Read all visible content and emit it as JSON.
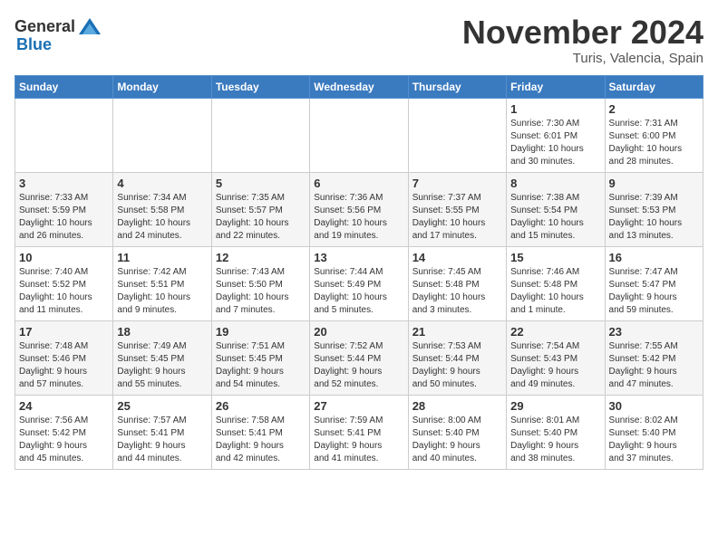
{
  "logo": {
    "general": "General",
    "blue": "Blue"
  },
  "header": {
    "month": "November 2024",
    "location": "Turis, Valencia, Spain"
  },
  "weekdays": [
    "Sunday",
    "Monday",
    "Tuesday",
    "Wednesday",
    "Thursday",
    "Friday",
    "Saturday"
  ],
  "weeks": [
    [
      {
        "day": "",
        "info": ""
      },
      {
        "day": "",
        "info": ""
      },
      {
        "day": "",
        "info": ""
      },
      {
        "day": "",
        "info": ""
      },
      {
        "day": "",
        "info": ""
      },
      {
        "day": "1",
        "info": "Sunrise: 7:30 AM\nSunset: 6:01 PM\nDaylight: 10 hours\nand 30 minutes."
      },
      {
        "day": "2",
        "info": "Sunrise: 7:31 AM\nSunset: 6:00 PM\nDaylight: 10 hours\nand 28 minutes."
      }
    ],
    [
      {
        "day": "3",
        "info": "Sunrise: 7:33 AM\nSunset: 5:59 PM\nDaylight: 10 hours\nand 26 minutes."
      },
      {
        "day": "4",
        "info": "Sunrise: 7:34 AM\nSunset: 5:58 PM\nDaylight: 10 hours\nand 24 minutes."
      },
      {
        "day": "5",
        "info": "Sunrise: 7:35 AM\nSunset: 5:57 PM\nDaylight: 10 hours\nand 22 minutes."
      },
      {
        "day": "6",
        "info": "Sunrise: 7:36 AM\nSunset: 5:56 PM\nDaylight: 10 hours\nand 19 minutes."
      },
      {
        "day": "7",
        "info": "Sunrise: 7:37 AM\nSunset: 5:55 PM\nDaylight: 10 hours\nand 17 minutes."
      },
      {
        "day": "8",
        "info": "Sunrise: 7:38 AM\nSunset: 5:54 PM\nDaylight: 10 hours\nand 15 minutes."
      },
      {
        "day": "9",
        "info": "Sunrise: 7:39 AM\nSunset: 5:53 PM\nDaylight: 10 hours\nand 13 minutes."
      }
    ],
    [
      {
        "day": "10",
        "info": "Sunrise: 7:40 AM\nSunset: 5:52 PM\nDaylight: 10 hours\nand 11 minutes."
      },
      {
        "day": "11",
        "info": "Sunrise: 7:42 AM\nSunset: 5:51 PM\nDaylight: 10 hours\nand 9 minutes."
      },
      {
        "day": "12",
        "info": "Sunrise: 7:43 AM\nSunset: 5:50 PM\nDaylight: 10 hours\nand 7 minutes."
      },
      {
        "day": "13",
        "info": "Sunrise: 7:44 AM\nSunset: 5:49 PM\nDaylight: 10 hours\nand 5 minutes."
      },
      {
        "day": "14",
        "info": "Sunrise: 7:45 AM\nSunset: 5:48 PM\nDaylight: 10 hours\nand 3 minutes."
      },
      {
        "day": "15",
        "info": "Sunrise: 7:46 AM\nSunset: 5:48 PM\nDaylight: 10 hours\nand 1 minute."
      },
      {
        "day": "16",
        "info": "Sunrise: 7:47 AM\nSunset: 5:47 PM\nDaylight: 9 hours\nand 59 minutes."
      }
    ],
    [
      {
        "day": "17",
        "info": "Sunrise: 7:48 AM\nSunset: 5:46 PM\nDaylight: 9 hours\nand 57 minutes."
      },
      {
        "day": "18",
        "info": "Sunrise: 7:49 AM\nSunset: 5:45 PM\nDaylight: 9 hours\nand 55 minutes."
      },
      {
        "day": "19",
        "info": "Sunrise: 7:51 AM\nSunset: 5:45 PM\nDaylight: 9 hours\nand 54 minutes."
      },
      {
        "day": "20",
        "info": "Sunrise: 7:52 AM\nSunset: 5:44 PM\nDaylight: 9 hours\nand 52 minutes."
      },
      {
        "day": "21",
        "info": "Sunrise: 7:53 AM\nSunset: 5:44 PM\nDaylight: 9 hours\nand 50 minutes."
      },
      {
        "day": "22",
        "info": "Sunrise: 7:54 AM\nSunset: 5:43 PM\nDaylight: 9 hours\nand 49 minutes."
      },
      {
        "day": "23",
        "info": "Sunrise: 7:55 AM\nSunset: 5:42 PM\nDaylight: 9 hours\nand 47 minutes."
      }
    ],
    [
      {
        "day": "24",
        "info": "Sunrise: 7:56 AM\nSunset: 5:42 PM\nDaylight: 9 hours\nand 45 minutes."
      },
      {
        "day": "25",
        "info": "Sunrise: 7:57 AM\nSunset: 5:41 PM\nDaylight: 9 hours\nand 44 minutes."
      },
      {
        "day": "26",
        "info": "Sunrise: 7:58 AM\nSunset: 5:41 PM\nDaylight: 9 hours\nand 42 minutes."
      },
      {
        "day": "27",
        "info": "Sunrise: 7:59 AM\nSunset: 5:41 PM\nDaylight: 9 hours\nand 41 minutes."
      },
      {
        "day": "28",
        "info": "Sunrise: 8:00 AM\nSunset: 5:40 PM\nDaylight: 9 hours\nand 40 minutes."
      },
      {
        "day": "29",
        "info": "Sunrise: 8:01 AM\nSunset: 5:40 PM\nDaylight: 9 hours\nand 38 minutes."
      },
      {
        "day": "30",
        "info": "Sunrise: 8:02 AM\nSunset: 5:40 PM\nDaylight: 9 hours\nand 37 minutes."
      }
    ]
  ]
}
